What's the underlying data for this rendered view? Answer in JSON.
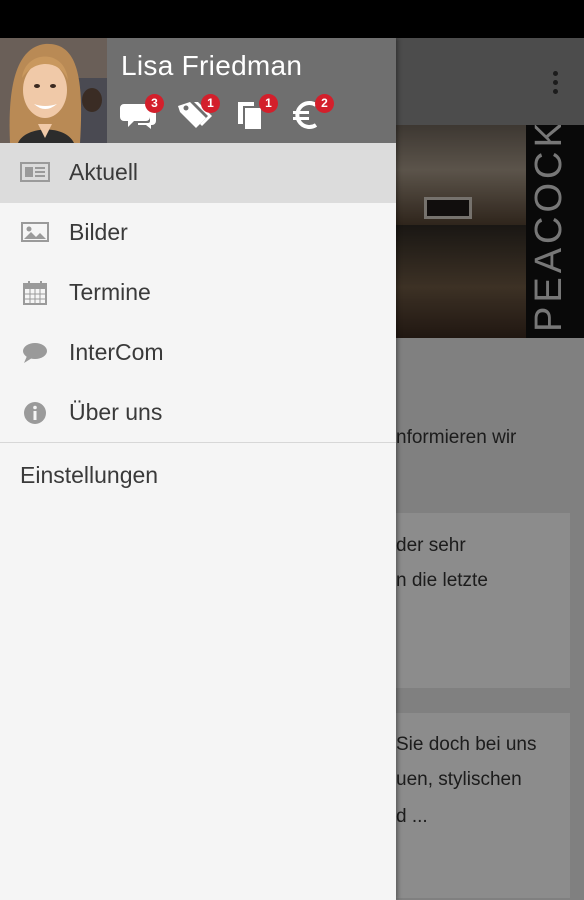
{
  "user": {
    "name": "Lisa Friedman"
  },
  "header_icons": [
    {
      "icon": "chat-bubbles-icon",
      "badge": "3"
    },
    {
      "icon": "tags-icon",
      "badge": "1"
    },
    {
      "icon": "documents-icon",
      "badge": "1"
    },
    {
      "icon": "euro-icon",
      "badge": "2"
    }
  ],
  "menu": {
    "items": [
      {
        "label": "Aktuell",
        "icon": "newspaper-icon",
        "active": true
      },
      {
        "label": "Bilder",
        "icon": "image-icon",
        "active": false
      },
      {
        "label": "Termine",
        "icon": "calendar-icon",
        "active": false
      },
      {
        "label": "InterCom",
        "icon": "speech-bubble-icon",
        "active": false
      },
      {
        "label": "Über uns",
        "icon": "info-icon",
        "active": false
      }
    ],
    "settings_label": "Einstellungen"
  },
  "background": {
    "banner_logo": "PEACOCK",
    "text_lines": [
      "nformieren wir",
      "der sehr",
      "n die letzte",
      "Sie doch bei uns",
      "uen, stylischen",
      "d ..."
    ]
  },
  "colors": {
    "header_bg": "#6f6f6f",
    "badge": "#d31f2b",
    "drawer_bg": "#f5f5f5",
    "active_item_bg": "#dcdcdc"
  }
}
